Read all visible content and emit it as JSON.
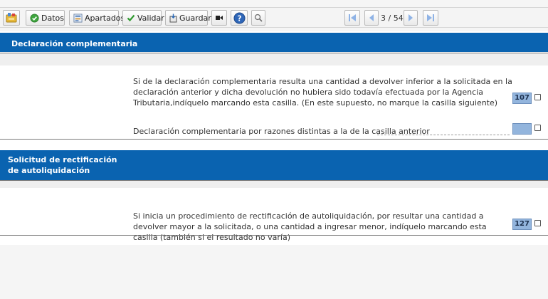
{
  "toolbar": {
    "datos_label": "Datos",
    "apartados_label": "Apartados",
    "validar_label": "Validar",
    "guardar_label": "Guardar",
    "page_indicator": "3 / 54"
  },
  "sections": [
    {
      "title": "Declaración complementaria",
      "items": [
        {
          "text": "Si de la declaración complementaria resulta una cantidad a devolver inferior a la solicitada en la declaración anterior y dicha devolución no hubiera sido todavía efectuada por la Agencia Tributaria,indíquelo marcando esta casilla. (En este supuesto, no marque la casilla siguiente)",
          "box": "107"
        },
        {
          "text": "Declaración complementaria por razones distintas a la de la casilla anterior",
          "box": ""
        }
      ]
    },
    {
      "title": "Solicitud de rectificación de autoliquidación",
      "items": [
        {
          "text": "Si inicia un procedimiento de rectificación de autoliquidación, por resultar una cantidad a devolver mayor a la solicitada, o una cantidad a ingresar menor, indíquelo marcando esta casilla (también si el resultado no varía)",
          "box": "127"
        }
      ]
    }
  ],
  "colors": {
    "section_header": "#0a63b0",
    "field_box": "#93b5dd",
    "nav_button": "#8fb3e6"
  }
}
